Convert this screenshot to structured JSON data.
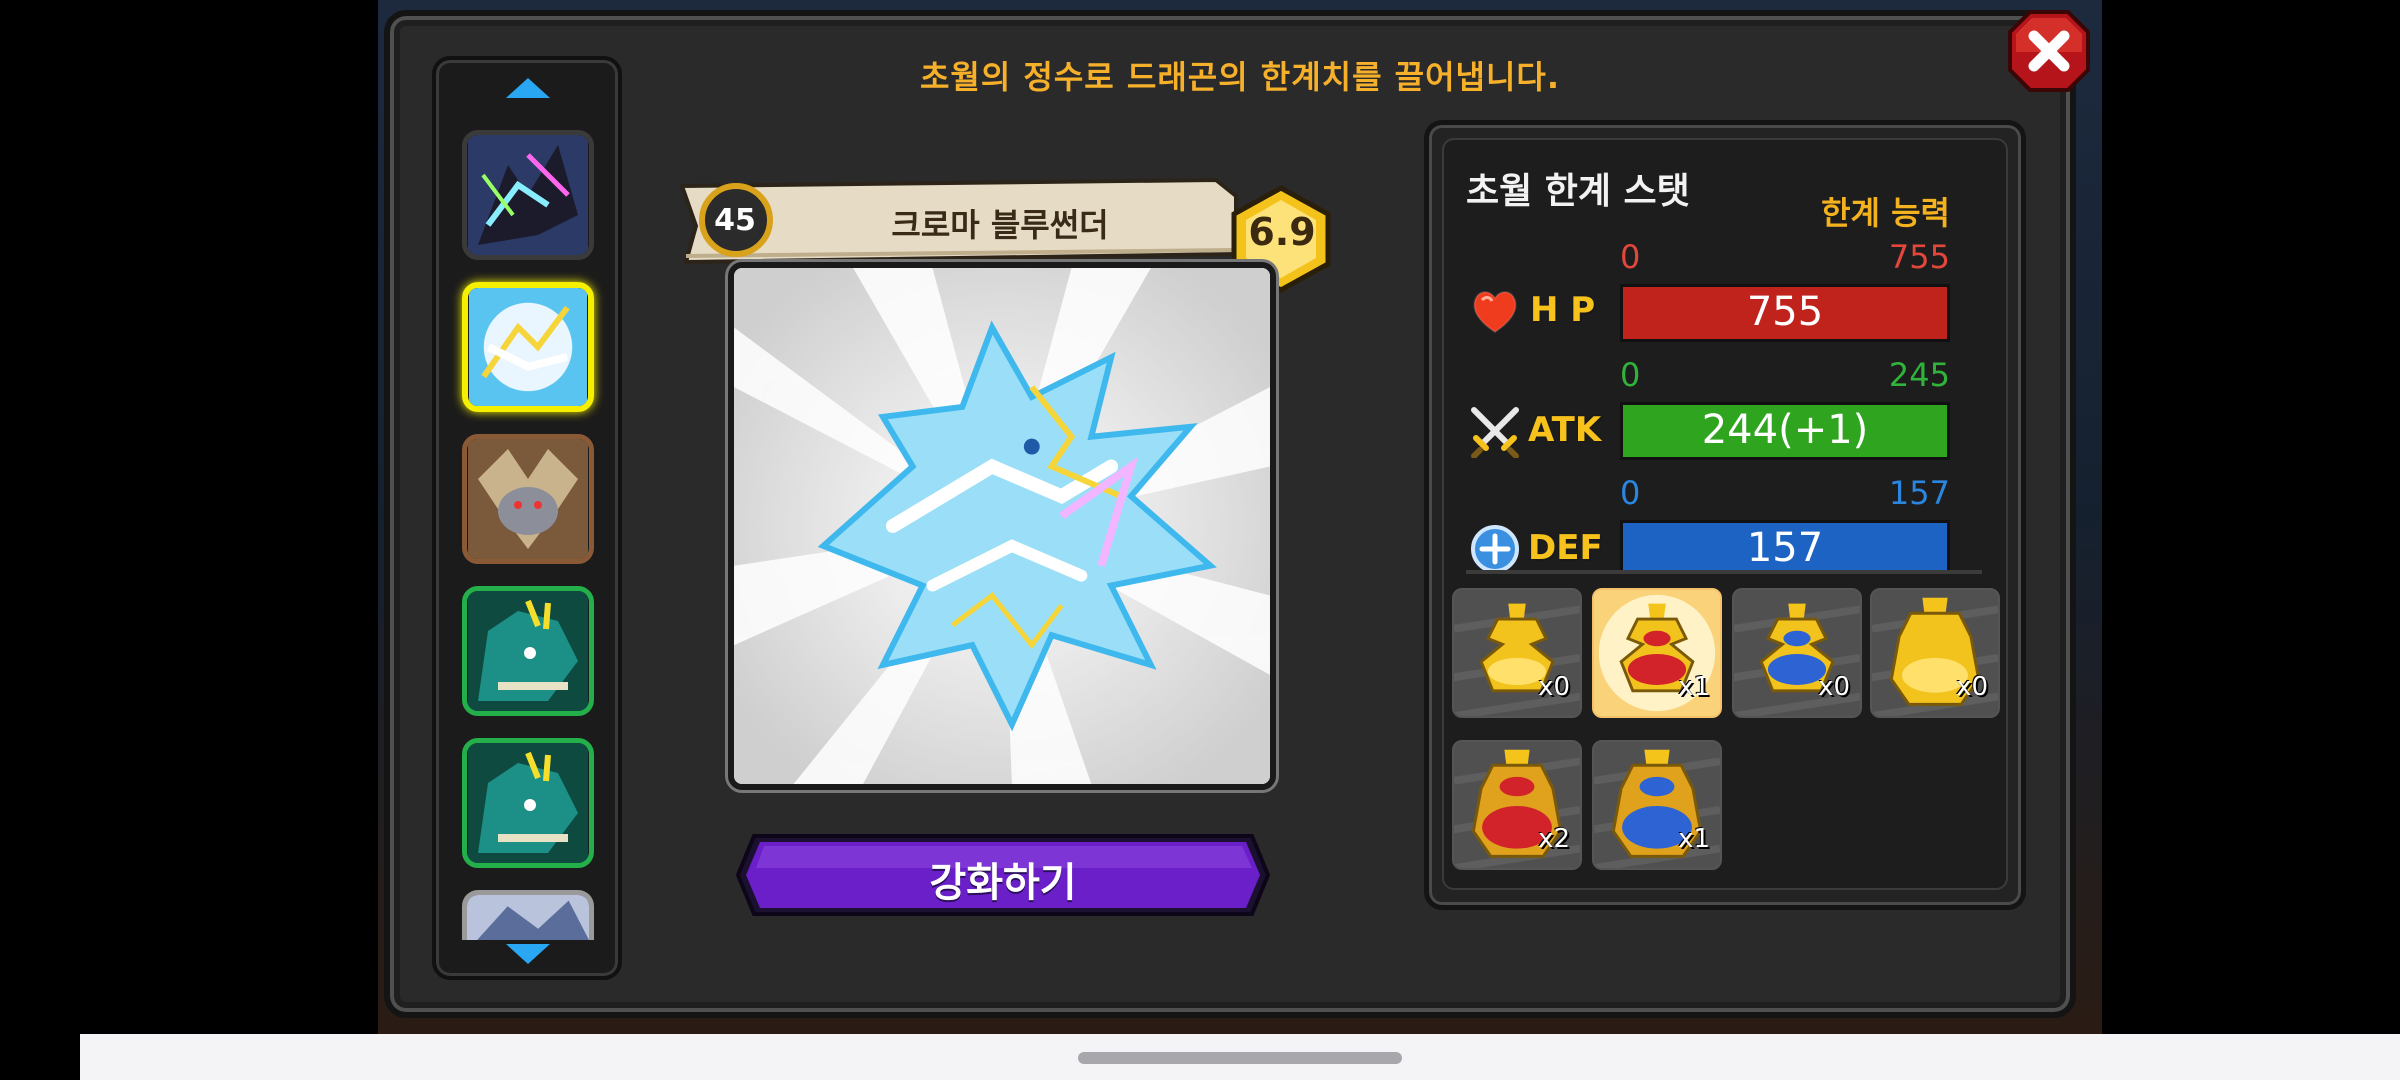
{
  "header": {
    "instruction": "초월의 정수로 드래곤의 한계치를 끌어냅니다."
  },
  "close": {
    "icon": "close-icon"
  },
  "dragon_list": {
    "thumbnails": [
      {
        "name": "chroma-black-dragon",
        "frame": "#3a3a3a",
        "selected": false
      },
      {
        "name": "chroma-bluethunder",
        "frame": "#f6f000",
        "selected": true
      },
      {
        "name": "brown-horned-dragon",
        "frame": "#8a5a36",
        "selected": false
      },
      {
        "name": "teal-dragon-1",
        "frame": "#23b04a",
        "selected": false
      },
      {
        "name": "teal-dragon-2",
        "frame": "#23b04a",
        "selected": false
      },
      {
        "name": "partial-dragon",
        "frame": "#9a9a9a",
        "selected": false
      }
    ]
  },
  "dragon": {
    "level": "45",
    "name": "크로마 블루썬더",
    "grade": "6.9"
  },
  "enhance_button": {
    "label": "강화하기",
    "color": "#6a1fc8"
  },
  "stats": {
    "title": "초월 한계 스탯",
    "limit_label": "한계 능력",
    "hp": {
      "label": "H P",
      "min": "0",
      "max": "755",
      "value_text": "755",
      "fill": 1.0,
      "color": "#c0221c",
      "range_color": "#e3473b"
    },
    "atk": {
      "label": "ATK",
      "min": "0",
      "max": "245",
      "value_text": "244(+1)",
      "fill": 0.996,
      "color": "#2fa41f",
      "range_color": "#30b33a"
    },
    "def": {
      "label": "DEF",
      "min": "0",
      "max": "157",
      "value_text": "157",
      "fill": 1.0,
      "color": "#1d63c4",
      "range_color": "#2a86e0"
    }
  },
  "items": [
    {
      "name": "gold-potion",
      "count": "x0",
      "highlighted": false
    },
    {
      "name": "red-potion",
      "count": "x1",
      "highlighted": true
    },
    {
      "name": "blue-potion",
      "count": "x0",
      "highlighted": false
    },
    {
      "name": "large-gold-potion",
      "count": "x0",
      "highlighted": false
    },
    {
      "name": "large-red-potion",
      "count": "x2",
      "highlighted": false
    },
    {
      "name": "large-blue-potion",
      "count": "x1",
      "highlighted": false
    }
  ]
}
